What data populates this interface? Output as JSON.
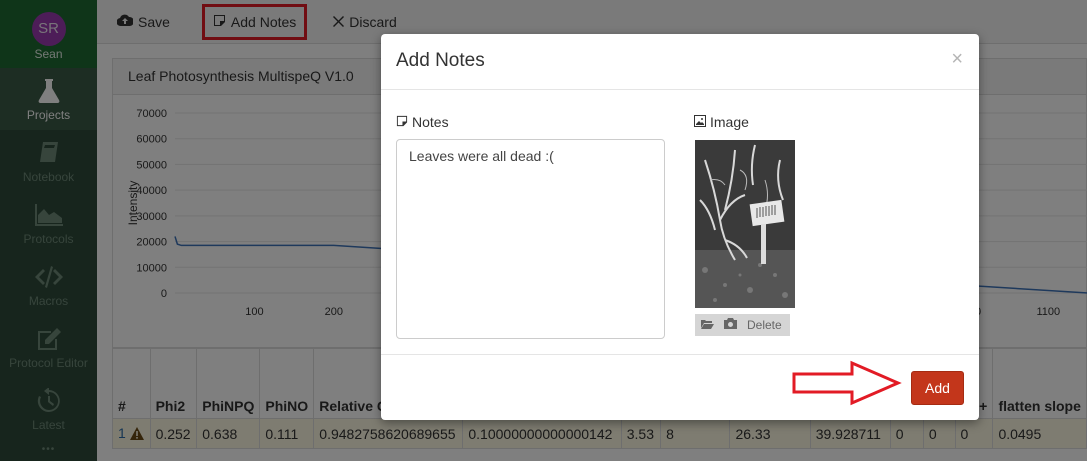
{
  "user": {
    "initials": "SR",
    "name": "Sean"
  },
  "sidebar": {
    "items": [
      {
        "label": "Projects",
        "icon": "flask-icon",
        "active": true
      },
      {
        "label": "Notebook",
        "icon": "book-icon",
        "active": false
      },
      {
        "label": "Protocols",
        "icon": "area-chart-icon",
        "active": false
      },
      {
        "label": "Macros",
        "icon": "code-icon",
        "active": false
      },
      {
        "label": "Protocol Editor",
        "icon": "edit-icon",
        "active": false
      },
      {
        "label": "Latest",
        "icon": "history-icon",
        "active": false
      }
    ]
  },
  "toolbar": {
    "save_label": "Save",
    "add_notes_label": "Add Notes",
    "discard_label": "Discard"
  },
  "panel": {
    "title": "Leaf Photosynthesis MultispeQ V1.0"
  },
  "chart_data": {
    "type": "line",
    "ylabel": "Intensity",
    "yticks": [
      70000,
      60000,
      50000,
      40000,
      30000,
      20000,
      10000,
      0
    ],
    "xticks_left": [
      100,
      200
    ],
    "xticks_right": [
      "1000",
      "1100"
    ],
    "ylim": [
      0,
      70000
    ],
    "xlim": [
      0,
      1150
    ],
    "series": [
      {
        "x": [
          0,
          3,
          8,
          200,
          1150
        ],
        "y": [
          22000,
          19000,
          18500,
          18500,
          0
        ]
      }
    ]
  },
  "table": {
    "headers": [
      "#",
      "Phi2",
      "PhiNPQ",
      "PhiNO",
      "Relative C",
      "",
      "",
      "",
      "",
      "",
      "",
      "",
      "gH+",
      "flatten slope"
    ],
    "row": {
      "num": "1",
      "cells": [
        "0.252",
        "0.638",
        "0.111",
        "0.9482758620689655",
        "0.10000000000000142",
        "3.53",
        "8",
        "26.33",
        "39.928711",
        "0",
        "0",
        "0",
        "0.0495"
      ]
    }
  },
  "modal": {
    "title": "Add Notes",
    "close": "×",
    "notes_label": "Notes",
    "notes_value": "Leaves were all dead :(",
    "image_label": "Image",
    "delete_label": "Delete",
    "add_label": "Add"
  },
  "colors": {
    "sidebar": "#2f4a3a",
    "user_header": "#1e6b32",
    "avatar": "#9b3bb0",
    "add_button": "#c3361b",
    "highlight": "#e21b25"
  }
}
